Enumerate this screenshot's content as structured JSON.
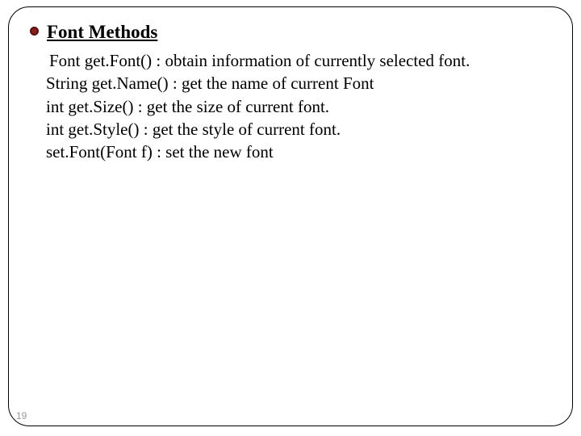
{
  "slide": {
    "title": "Font Methods",
    "lines": [
      "Font get.Font() : obtain information of currently selected font.",
      "String get.Name() : get the name of current Font",
      "int get.Size() : get the size of current font.",
      "int get.Style() : get the style of current font.",
      "set.Font(Font f) : set the new font"
    ],
    "page_number": "19"
  }
}
